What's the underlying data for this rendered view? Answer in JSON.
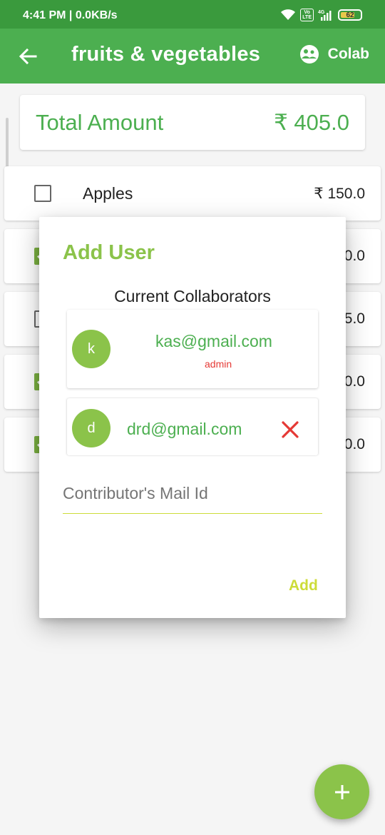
{
  "status_bar": {
    "time_text": "4:41 PM | 0.0KB/s",
    "volte": "Vo LTE",
    "network": "4G",
    "battery": "62"
  },
  "app_bar": {
    "title": "fruits & vegetables",
    "colab_label": "Colab"
  },
  "total": {
    "label": "Total Amount",
    "amount": "₹ 405.0"
  },
  "items": [
    {
      "name": "Apples",
      "price": "₹ 150.0",
      "checked": false
    },
    {
      "name": "",
      "price": "0.0",
      "checked": true
    },
    {
      "name": "",
      "price": "5.0",
      "checked": false
    },
    {
      "name": "",
      "price": "0.0",
      "checked": true
    },
    {
      "name": "",
      "price": "0.0",
      "checked": true
    }
  ],
  "dialog": {
    "title": "Add User",
    "subtitle": "Current Collaborators",
    "collaborators": [
      {
        "initial": "k",
        "email": "kas@gmail.com",
        "role": "admin"
      },
      {
        "initial": "d",
        "email": "drd@gmail.com",
        "role": ""
      }
    ],
    "input_placeholder": "Contributor's Mail Id",
    "input_value": "",
    "add_label": "Add"
  },
  "fab": {
    "icon": "plus-icon"
  },
  "colors": {
    "status_bar": "#3a9a3d",
    "primary": "#4caf50",
    "accent_light": "#8bc34a",
    "lime": "#cddc39",
    "remove": "#e53935"
  }
}
